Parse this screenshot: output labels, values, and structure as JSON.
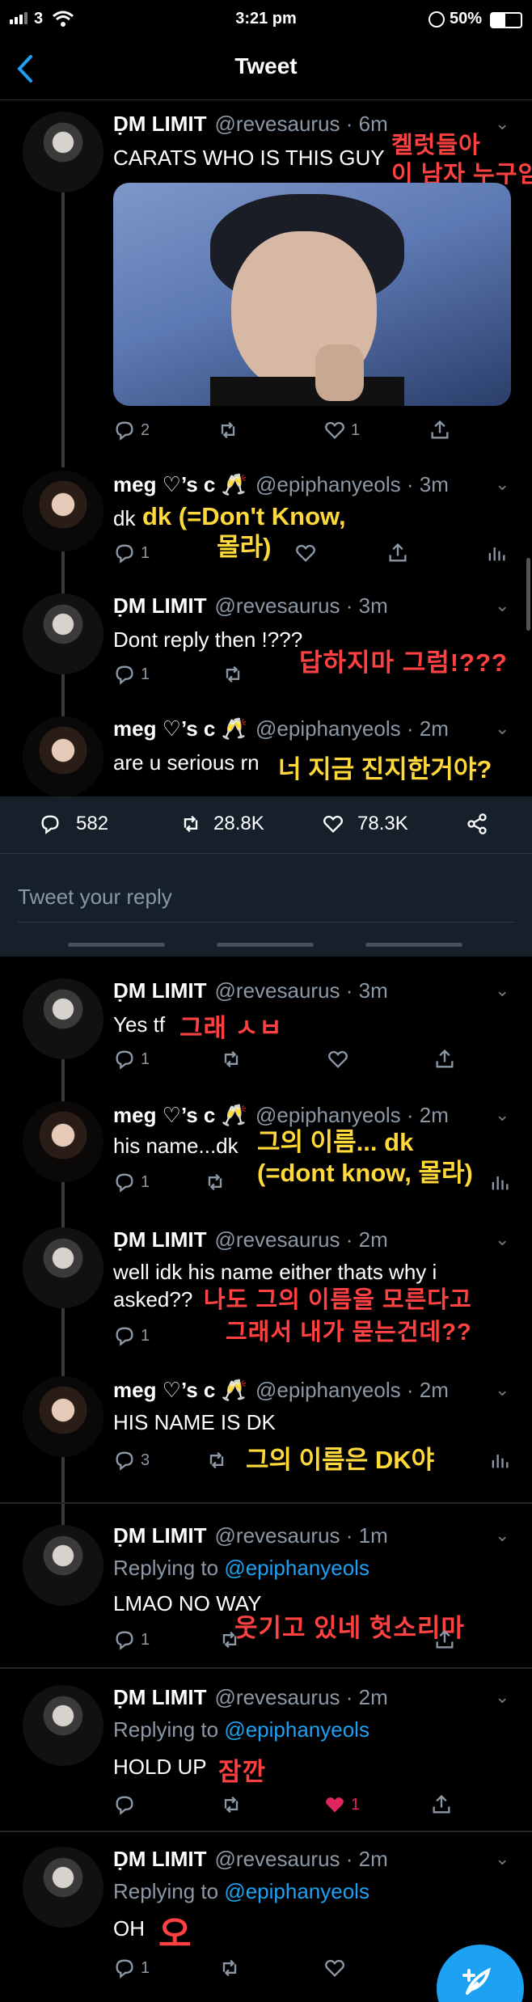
{
  "status": {
    "signal": "3",
    "time": "3:21 pm",
    "battery": "50%"
  },
  "nav": {
    "title": "Tweet"
  },
  "tweets": [
    {
      "name": "ḌM LIMIT",
      "handle": "@revesaurus · 6m",
      "text": "CARATS WHO IS THIS GUY",
      "overlay": "켈럿들아\n이 남자 누구임",
      "reply": "2",
      "rt": "",
      "like": "1"
    },
    {
      "name": "meg ♡’s c 🥂",
      "handle": "@epiphanyeols · 3m",
      "text": "dk",
      "overlay": "dk (=Don't Know,\n몰라)",
      "reply": "1",
      "rt": "",
      "like": ""
    },
    {
      "name": "ḌM LIMIT",
      "handle": "@revesaurus · 3m",
      "text": "Dont reply then !???",
      "overlay": "답하지마 그럼!???",
      "reply": "1",
      "rt": "",
      "like": ""
    },
    {
      "name": "meg ♡’s c 🥂",
      "handle": "@epiphanyeols · 2m",
      "text": "are u serious rn",
      "overlay": "너 지금 진지한거야?",
      "reply": "",
      "rt": "",
      "like": ""
    },
    {
      "name": "ḌM LIMIT",
      "handle": "@revesaurus · 3m",
      "text": "Yes tf",
      "overlay": "그래 ㅅㅂ",
      "reply": "1",
      "rt": "",
      "like": ""
    },
    {
      "name": "meg ♡’s c 🥂",
      "handle": "@epiphanyeols · 2m",
      "text": "his name...dk",
      "overlay": "그의 이름... dk\n(=dont know, 몰라)",
      "reply": "1",
      "rt": "",
      "like": ""
    },
    {
      "name": "ḌM LIMIT",
      "handle": "@revesaurus · 2m",
      "text": "well idk his name either thats why i\nasked??",
      "overlay": "나도 그의 이름을 모른다고\n그래서 내가 묻는건데??",
      "reply": "1",
      "rt": "",
      "like": ""
    },
    {
      "name": "meg ♡’s c 🥂",
      "handle": "@epiphanyeols · 2m",
      "text": "HIS NAME IS DK",
      "overlay": "그의 이름은 DK야",
      "reply": "3",
      "rt": "",
      "like": ""
    },
    {
      "name": "ḌM LIMIT",
      "handle": "@revesaurus · 1m",
      "replying_prefix": "Replying to",
      "replying_to": "@epiphanyeols",
      "text": "LMAO NO WAY",
      "overlay": "웃기고 있네 헛소리마",
      "reply": "1",
      "rt": "",
      "like": ""
    },
    {
      "name": "ḌM LIMIT",
      "handle": "@revesaurus · 2m",
      "replying_prefix": "Replying to",
      "replying_to": "@epiphanyeols",
      "text": "HOLD UP",
      "overlay": "잠깐",
      "reply": "",
      "rt": "",
      "like": "1"
    },
    {
      "name": "ḌM LIMIT",
      "handle": "@revesaurus · 2m",
      "replying_prefix": "Replying to",
      "replying_to": "@epiphanyeols",
      "text": "OH",
      "overlay": "오",
      "reply": "1",
      "rt": "",
      "like": ""
    }
  ],
  "stats": {
    "replies": "582",
    "retweets": "28.8K",
    "likes": "78.3K"
  },
  "reply_box": {
    "placeholder": "Tweet your reply"
  },
  "colors": {
    "background": "#000000",
    "accent": "#1da1f2",
    "overlay_red": "#ff4141",
    "overlay_yellow": "#ffd83a",
    "like_active": "#e0245e"
  },
  "icons": [
    "signal-icon",
    "wifi-icon",
    "battery-icon",
    "back-chevron-icon",
    "reply-icon",
    "retweet-icon",
    "like-icon",
    "share-icon",
    "analytics-icon",
    "compose-icon"
  ]
}
